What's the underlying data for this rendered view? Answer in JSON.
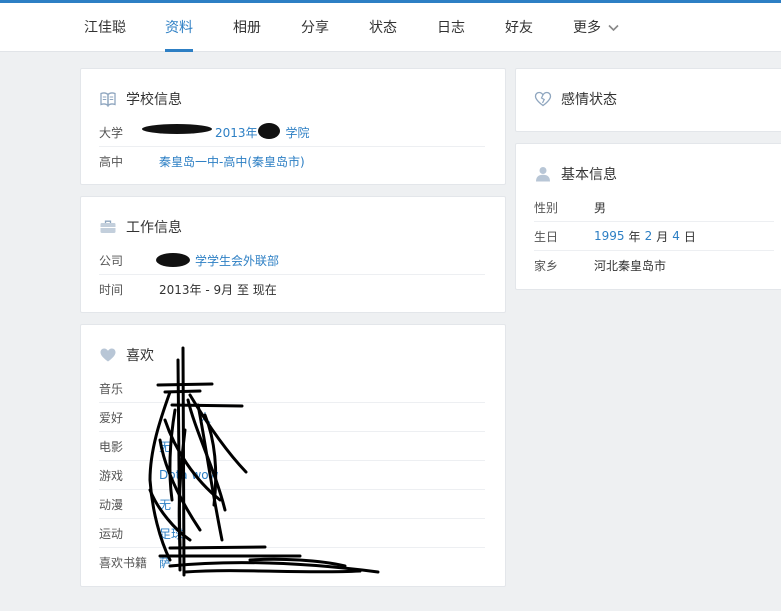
{
  "nav": {
    "items": [
      "江佳聪",
      "资料",
      "相册",
      "分享",
      "状态",
      "日志",
      "好友"
    ],
    "more_label": "更多",
    "active_index": 1
  },
  "school": {
    "title": "学校信息",
    "rows": [
      {
        "label": "大学",
        "value": "2013年",
        "value_tail": "学院"
      },
      {
        "label": "高中",
        "value": "秦皇岛一中-高中(秦皇岛市)"
      }
    ]
  },
  "work": {
    "title": "工作信息",
    "rows": [
      {
        "label": "公司",
        "value": "学学生会外联部"
      },
      {
        "label": "时间",
        "value": "2013年 - 9月 至 现在"
      }
    ]
  },
  "likes": {
    "title": "喜欢",
    "rows": [
      {
        "label": "音乐",
        "value": ""
      },
      {
        "label": "爱好",
        "value": "人"
      },
      {
        "label": "电影",
        "value": "无"
      },
      {
        "label": "游戏",
        "value": "Dota wow"
      },
      {
        "label": "动漫",
        "value": "无"
      },
      {
        "label": "运动",
        "value": "足球"
      },
      {
        "label": "喜欢书籍",
        "value": "萨"
      }
    ]
  },
  "relationship": {
    "title": "感情状态"
  },
  "basic": {
    "title": "基本信息",
    "rows": [
      {
        "label": "性别",
        "value": "男"
      },
      {
        "label": "生日",
        "value": "1995",
        "value_mid": "年",
        "month": "2",
        "month_unit": "月",
        "day": "4",
        "day_unit": "日"
      },
      {
        "label": "家乡",
        "value": "河北秦皇岛市"
      }
    ]
  },
  "colors": {
    "accent": "#2d7fc4",
    "background": "#eef0f2",
    "card": "#ffffff"
  }
}
